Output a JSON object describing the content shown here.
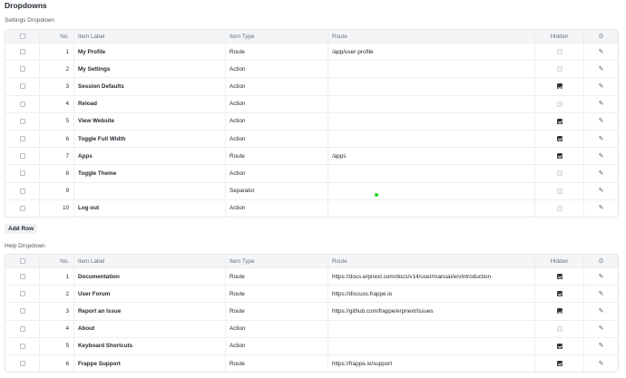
{
  "title": "Dropdowns",
  "settings": {
    "label": "Settings Dropdown",
    "add_row": "Add Row"
  },
  "help": {
    "label": "Help Dropdown"
  },
  "columns": {
    "no": "No.",
    "label": "Item Label",
    "type": "Item Type",
    "route": "Route",
    "hidden": "Hidden"
  },
  "settings_rows": [
    {
      "no": "1",
      "label": "My Profile",
      "type": "Route",
      "route": "/app/user-profile",
      "hidden": "disabled"
    },
    {
      "no": "2",
      "label": "My Settings",
      "type": "Action",
      "route": "",
      "hidden": "disabled"
    },
    {
      "no": "3",
      "label": "Session Defaults",
      "type": "Action",
      "route": "",
      "hidden": "checked"
    },
    {
      "no": "4",
      "label": "Reload",
      "type": "Action",
      "route": "",
      "hidden": "disabled"
    },
    {
      "no": "5",
      "label": "View Website",
      "type": "Action",
      "route": "",
      "hidden": "checked"
    },
    {
      "no": "6",
      "label": "Toggle Full Width",
      "type": "Action",
      "route": "",
      "hidden": "checked"
    },
    {
      "no": "7",
      "label": "Apps",
      "type": "Route",
      "route": "/apps",
      "hidden": "checked"
    },
    {
      "no": "8",
      "label": "Toggle Theme",
      "type": "Action",
      "route": "",
      "hidden": "disabled"
    },
    {
      "no": "9",
      "label": "",
      "type": "Separator",
      "route": "",
      "hidden": "disabled"
    },
    {
      "no": "10",
      "label": "Log out",
      "type": "Action",
      "route": "",
      "hidden": "disabled"
    }
  ],
  "help_rows": [
    {
      "no": "1",
      "label": "Documentation",
      "type": "Route",
      "route": "https://docs.erpnext.com/docs/v14/user/manual/en/introduction",
      "hidden": "checked"
    },
    {
      "no": "2",
      "label": "User Forum",
      "type": "Route",
      "route": "https://discuss.frappe.io",
      "hidden": "checked"
    },
    {
      "no": "3",
      "label": "Report an Issue",
      "type": "Route",
      "route": "https://github.com/frappe/erpnext/issues",
      "hidden": "checked"
    },
    {
      "no": "4",
      "label": "About",
      "type": "Action",
      "route": "",
      "hidden": "disabled"
    },
    {
      "no": "5",
      "label": "Keyboard Shortcuts",
      "type": "Action",
      "route": "",
      "hidden": "checked"
    },
    {
      "no": "6",
      "label": "Frappe Support",
      "type": "Route",
      "route": "https://frappe.io/support",
      "hidden": "checked"
    }
  ]
}
